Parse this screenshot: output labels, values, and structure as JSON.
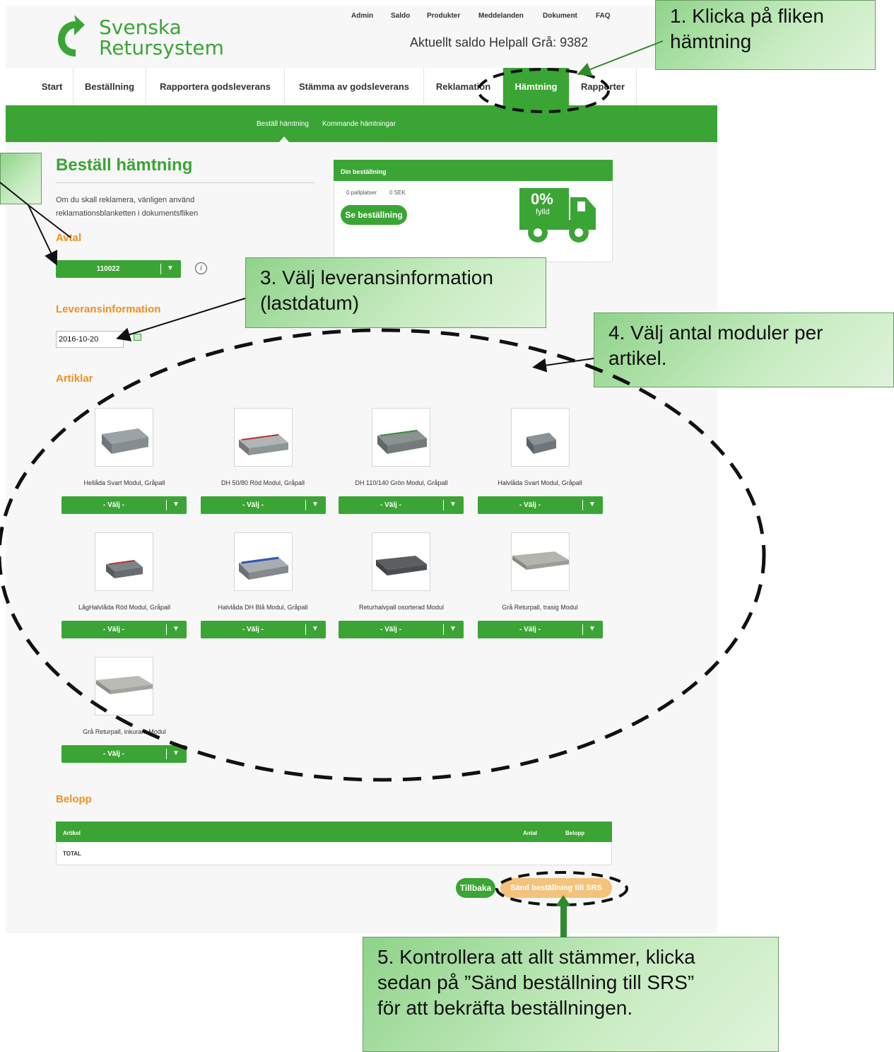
{
  "header": {
    "logo_line1": "Svenska",
    "logo_line2": "Retursystem",
    "top_links": [
      "Admin",
      "Saldo",
      "Produkter",
      "Meddelanden",
      "Dokument",
      "FAQ"
    ],
    "saldo_text": "Aktuellt saldo Helpall Grå: 9382"
  },
  "nav": {
    "tabs": [
      "Start",
      "Beställning",
      "Rapportera godsleverans",
      "Stämma av godsleverans",
      "Reklamation",
      "Hämtning",
      "Rapporter"
    ],
    "active": "Hämtning",
    "sub": [
      "Beställ hämtning",
      "Kommande hämtningar"
    ]
  },
  "main": {
    "title": "Beställ hämtning",
    "intro_line1": "Om du skall reklamera, vänligen använd",
    "intro_line2": "reklamationsblanketten i dokumentsfliken",
    "avtal_heading": "Avtal",
    "avtal_value": "110022",
    "leverans_heading": "Leveransinformation",
    "date_value": "2016-10-20",
    "artiklar_heading": "Artiklar",
    "select_label": "- Välj -",
    "products": [
      "Hellåda Svart Modul, Gråpall",
      "DH 50/80 Röd Modul, Gråpall",
      "DH 110/140 Grön Modul, Gråpall",
      "Halvlåda Svart Modul, Gråpall",
      "LågHalvlåda Röd Modul, Gråpall",
      "Halvlåda DH Blå Modul, Gråpall",
      "Returhalvpall osorterad Modul",
      "Grå Returpall, trasig Modul",
      "Grå Returpall, inkurant Modul"
    ],
    "belopp_heading": "Belopp",
    "table_headers": {
      "artikel": "Artikel",
      "antal": "Antal",
      "belopp": "Belopp"
    },
    "table_total": "TOTAL",
    "back_button": "Tillbaka",
    "submit_button": "Sänd beställning till SRS"
  },
  "order_card": {
    "title": "Din beställning",
    "stats_pallets": "0 pallplatser",
    "stats_sek": "0 SEK",
    "see_button": "Se beställning",
    "fill_percent": "0%",
    "fill_label": "fylld"
  },
  "callouts": {
    "c1": [
      "1. Klicka på fliken",
      "hämtning"
    ],
    "c3": [
      "3. Välj leveransinformation",
      "(lastdatum)"
    ],
    "c4": [
      "4. Välj antal moduler per",
      "artikel."
    ],
    "c5": [
      "5. Kontrollera att allt stämmer, klicka",
      "sedan på ”Sänd beställning till SRS”",
      "för att bekräfta beställningen."
    ]
  },
  "colors": {
    "brand_green": "#3aa535",
    "accent_orange": "#f0901e",
    "submit_fill": "#f4c27a"
  }
}
